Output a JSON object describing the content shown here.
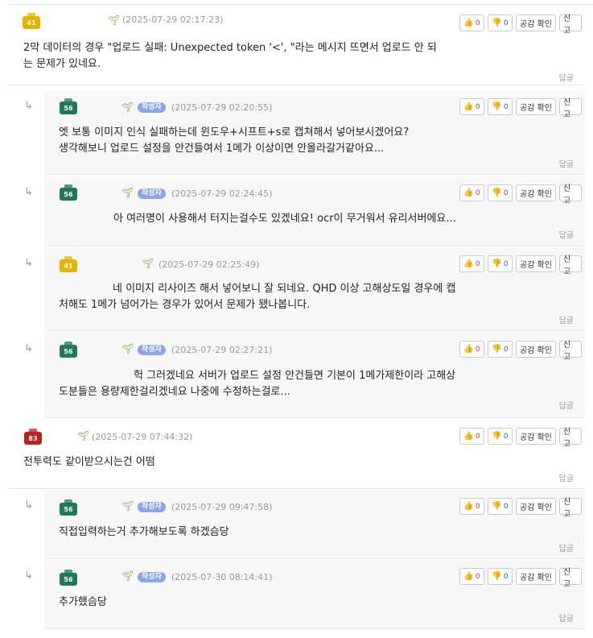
{
  "labels": {
    "like_icon": "👍",
    "dislike_icon": "👎",
    "agree": "공감 확인",
    "report": "신고",
    "reply": "답글",
    "author_badge": "작성자",
    "reply_arrow": "↳"
  },
  "comments": [
    {
      "level": "41",
      "date": "(2025-07-29 02:17:23)",
      "likes": "0",
      "dislikes": "0",
      "text": "2막 데이터의 경우 \"업로드 실패: Unexpected token '<', \"라는 메시지 뜨면서 업로드 안 되\n는 문제가 있네요."
    },
    {
      "level": "56",
      "date": "(2025-07-29 02:20:55)",
      "likes": "0",
      "dislikes": "0",
      "text": "엣 보통 이미지 인식 실패하는데 윈도우+시프트+s로 캡쳐해서 넣어보시겠어요?\n생각해보니 업로드 설정을 안건들여서 1메가 이상이면 안올라갈거같아요..."
    },
    {
      "level": "56",
      "date": "(2025-07-29 02:24:45)",
      "likes": "0",
      "dislikes": "0",
      "text": "아 여러명이 사용해서 터지는걸수도 있겠네요! ocr이 무거워서 유리서버에요..."
    },
    {
      "level": "41",
      "date": "(2025-07-29 02:25:49)",
      "likes": "0",
      "dislikes": "0",
      "text": "네 이미지 리사이즈 해서 넣어보니 잘 되네요. QHD 이상 고해상도일 경우에 캡\n처해도 1메가 넘어가는 경우가 있어서 문제가 됐나봅니다."
    },
    {
      "level": "56",
      "date": "(2025-07-29 02:27:21)",
      "likes": "0",
      "dislikes": "0",
      "text": "헉 그러겠네요 서버가 업로드 설정 안건들면 기본이 1메가제한이라 고해상\n도분들은 용량제한걸리겠네요 나중에 수정하는걸로..."
    },
    {
      "level": "83",
      "date": "(2025-07-29 07:44:32)",
      "likes": "0",
      "dislikes": "0",
      "text": "전투력도 같이받으시는건 어떰"
    },
    {
      "level": "56",
      "date": "(2025-07-29 09:47:58)",
      "likes": "0",
      "dislikes": "0",
      "text": "직접입력하는거 추가해보도록 하겠슴당"
    },
    {
      "level": "56",
      "date": "(2025-07-30 08:14:41)",
      "likes": "0",
      "dislikes": "0",
      "text": "추가했슴당"
    }
  ]
}
